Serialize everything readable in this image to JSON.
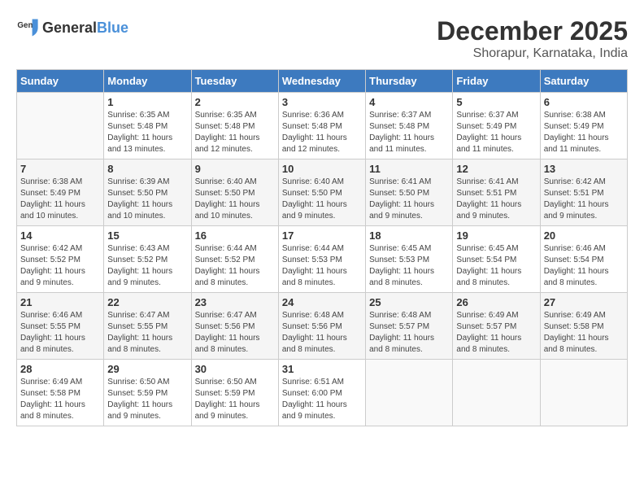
{
  "header": {
    "logo_general": "General",
    "logo_blue": "Blue",
    "month": "December 2025",
    "location": "Shorapur, Karnataka, India"
  },
  "days_of_week": [
    "Sunday",
    "Monday",
    "Tuesday",
    "Wednesday",
    "Thursday",
    "Friday",
    "Saturday"
  ],
  "weeks": [
    [
      {
        "day": "",
        "info": ""
      },
      {
        "day": "1",
        "info": "Sunrise: 6:35 AM\nSunset: 5:48 PM\nDaylight: 11 hours\nand 13 minutes."
      },
      {
        "day": "2",
        "info": "Sunrise: 6:35 AM\nSunset: 5:48 PM\nDaylight: 11 hours\nand 12 minutes."
      },
      {
        "day": "3",
        "info": "Sunrise: 6:36 AM\nSunset: 5:48 PM\nDaylight: 11 hours\nand 12 minutes."
      },
      {
        "day": "4",
        "info": "Sunrise: 6:37 AM\nSunset: 5:48 PM\nDaylight: 11 hours\nand 11 minutes."
      },
      {
        "day": "5",
        "info": "Sunrise: 6:37 AM\nSunset: 5:49 PM\nDaylight: 11 hours\nand 11 minutes."
      },
      {
        "day": "6",
        "info": "Sunrise: 6:38 AM\nSunset: 5:49 PM\nDaylight: 11 hours\nand 11 minutes."
      }
    ],
    [
      {
        "day": "7",
        "info": "Sunrise: 6:38 AM\nSunset: 5:49 PM\nDaylight: 11 hours\nand 10 minutes."
      },
      {
        "day": "8",
        "info": "Sunrise: 6:39 AM\nSunset: 5:50 PM\nDaylight: 11 hours\nand 10 minutes."
      },
      {
        "day": "9",
        "info": "Sunrise: 6:40 AM\nSunset: 5:50 PM\nDaylight: 11 hours\nand 10 minutes."
      },
      {
        "day": "10",
        "info": "Sunrise: 6:40 AM\nSunset: 5:50 PM\nDaylight: 11 hours\nand 9 minutes."
      },
      {
        "day": "11",
        "info": "Sunrise: 6:41 AM\nSunset: 5:50 PM\nDaylight: 11 hours\nand 9 minutes."
      },
      {
        "day": "12",
        "info": "Sunrise: 6:41 AM\nSunset: 5:51 PM\nDaylight: 11 hours\nand 9 minutes."
      },
      {
        "day": "13",
        "info": "Sunrise: 6:42 AM\nSunset: 5:51 PM\nDaylight: 11 hours\nand 9 minutes."
      }
    ],
    [
      {
        "day": "14",
        "info": "Sunrise: 6:42 AM\nSunset: 5:52 PM\nDaylight: 11 hours\nand 9 minutes."
      },
      {
        "day": "15",
        "info": "Sunrise: 6:43 AM\nSunset: 5:52 PM\nDaylight: 11 hours\nand 9 minutes."
      },
      {
        "day": "16",
        "info": "Sunrise: 6:44 AM\nSunset: 5:52 PM\nDaylight: 11 hours\nand 8 minutes."
      },
      {
        "day": "17",
        "info": "Sunrise: 6:44 AM\nSunset: 5:53 PM\nDaylight: 11 hours\nand 8 minutes."
      },
      {
        "day": "18",
        "info": "Sunrise: 6:45 AM\nSunset: 5:53 PM\nDaylight: 11 hours\nand 8 minutes."
      },
      {
        "day": "19",
        "info": "Sunrise: 6:45 AM\nSunset: 5:54 PM\nDaylight: 11 hours\nand 8 minutes."
      },
      {
        "day": "20",
        "info": "Sunrise: 6:46 AM\nSunset: 5:54 PM\nDaylight: 11 hours\nand 8 minutes."
      }
    ],
    [
      {
        "day": "21",
        "info": "Sunrise: 6:46 AM\nSunset: 5:55 PM\nDaylight: 11 hours\nand 8 minutes."
      },
      {
        "day": "22",
        "info": "Sunrise: 6:47 AM\nSunset: 5:55 PM\nDaylight: 11 hours\nand 8 minutes."
      },
      {
        "day": "23",
        "info": "Sunrise: 6:47 AM\nSunset: 5:56 PM\nDaylight: 11 hours\nand 8 minutes."
      },
      {
        "day": "24",
        "info": "Sunrise: 6:48 AM\nSunset: 5:56 PM\nDaylight: 11 hours\nand 8 minutes."
      },
      {
        "day": "25",
        "info": "Sunrise: 6:48 AM\nSunset: 5:57 PM\nDaylight: 11 hours\nand 8 minutes."
      },
      {
        "day": "26",
        "info": "Sunrise: 6:49 AM\nSunset: 5:57 PM\nDaylight: 11 hours\nand 8 minutes."
      },
      {
        "day": "27",
        "info": "Sunrise: 6:49 AM\nSunset: 5:58 PM\nDaylight: 11 hours\nand 8 minutes."
      }
    ],
    [
      {
        "day": "28",
        "info": "Sunrise: 6:49 AM\nSunset: 5:58 PM\nDaylight: 11 hours\nand 8 minutes."
      },
      {
        "day": "29",
        "info": "Sunrise: 6:50 AM\nSunset: 5:59 PM\nDaylight: 11 hours\nand 9 minutes."
      },
      {
        "day": "30",
        "info": "Sunrise: 6:50 AM\nSunset: 5:59 PM\nDaylight: 11 hours\nand 9 minutes."
      },
      {
        "day": "31",
        "info": "Sunrise: 6:51 AM\nSunset: 6:00 PM\nDaylight: 11 hours\nand 9 minutes."
      },
      {
        "day": "",
        "info": ""
      },
      {
        "day": "",
        "info": ""
      },
      {
        "day": "",
        "info": ""
      }
    ]
  ]
}
